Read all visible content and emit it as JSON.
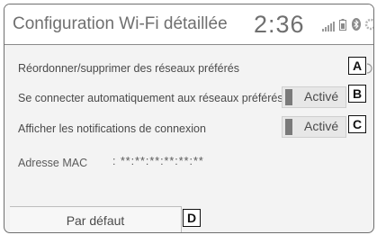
{
  "header": {
    "title": "Configuration Wi-Fi détaillée",
    "time": "2:36"
  },
  "status_icons": [
    "signal-bars-icon",
    "battery-icon",
    "bluetooth-icon"
  ],
  "rows": [
    {
      "label": "Réordonner/supprimer des réseaux préférés",
      "callout": "A"
    },
    {
      "label": "Se connecter automatiquement aux réseaux préférés",
      "toggle": "Activé",
      "callout": "B"
    },
    {
      "label": "Afficher les notifications de connexion",
      "toggle": "Activé",
      "callout": "C"
    }
  ],
  "mac": {
    "label": "Adresse MAC",
    "value": ": **:**:**:**:**:**"
  },
  "default_button": {
    "label": "Par défaut",
    "callout": "D"
  }
}
